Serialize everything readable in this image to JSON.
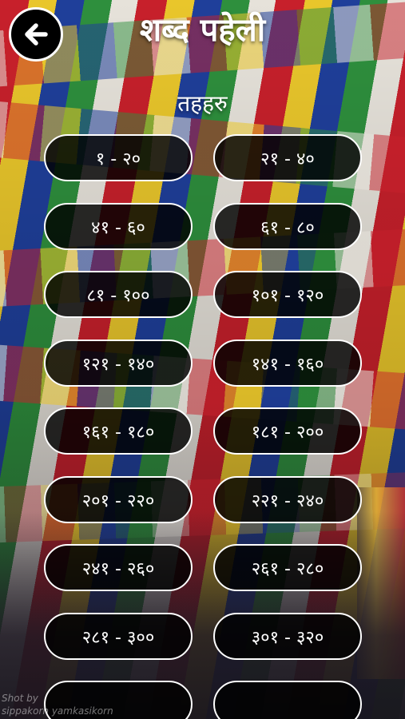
{
  "header": {
    "title": "शब्द पहेली",
    "back_icon": "arrow-left-icon"
  },
  "section": {
    "title": "तहहरु"
  },
  "levels": [
    {
      "label": "१ - २०"
    },
    {
      "label": "२१ - ४०"
    },
    {
      "label": "४१ - ६०"
    },
    {
      "label": "६१ - ८०"
    },
    {
      "label": "८१ - १००"
    },
    {
      "label": "१०१ - १२०"
    },
    {
      "label": "१२१ - १४०"
    },
    {
      "label": "१४१ - १६०"
    },
    {
      "label": "१६१ - १८०"
    },
    {
      "label": "१८१ - २००"
    },
    {
      "label": "२०१ - २२०"
    },
    {
      "label": "२२१ - २४०"
    },
    {
      "label": "२४१ - २६०"
    },
    {
      "label": "२६१ - २८०"
    },
    {
      "label": "२८१ - ३००"
    },
    {
      "label": "३०१ - ३२०"
    },
    {
      "label": ""
    },
    {
      "label": ""
    }
  ],
  "photo_credit": {
    "line1": "Shot by",
    "line2": "sippakorn yamkasikorn"
  },
  "colors": {
    "button_bg": "#000000",
    "button_border": "#ffffff",
    "text": "#ffffff"
  }
}
